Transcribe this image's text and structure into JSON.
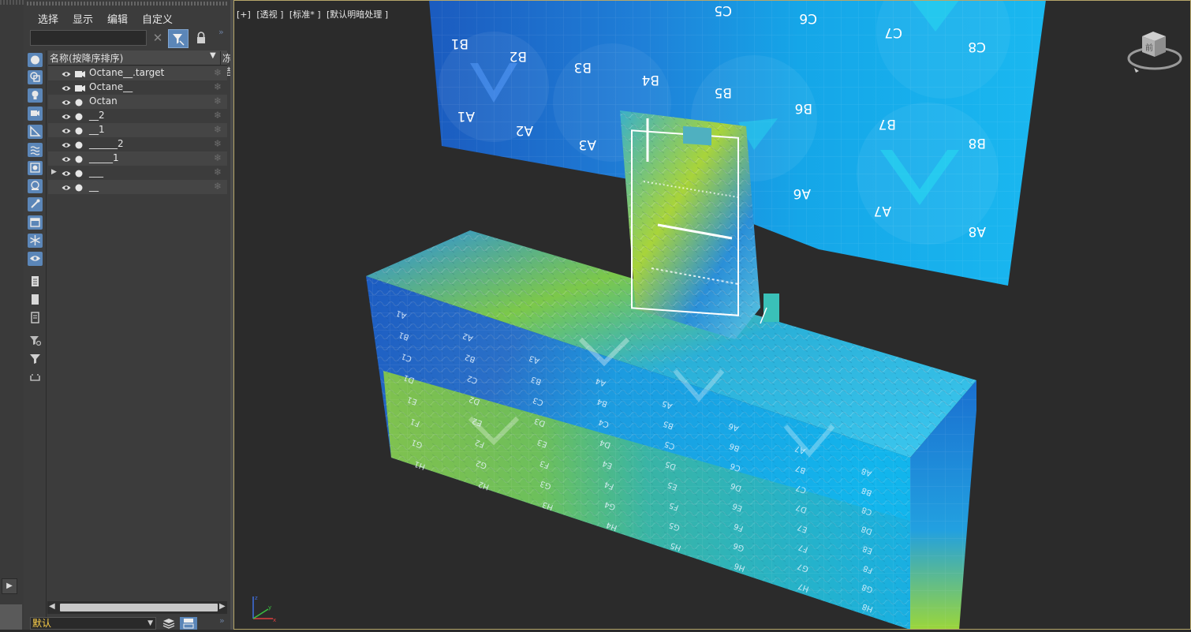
{
  "explorer": {
    "menu": {
      "select": "选择",
      "display": "显示",
      "edit": "编辑",
      "customize": "自定义"
    },
    "search": {
      "value": "",
      "placeholder": ""
    },
    "columns": {
      "name": "名称(按降序排序)",
      "frozen": "冻结"
    },
    "items": [
      {
        "label": "Octane__.target",
        "type": "camera",
        "expanded": false
      },
      {
        "label": "Octane__",
        "type": "camera",
        "expanded": false
      },
      {
        "label": "Octan",
        "type": "geometry",
        "expanded": false
      },
      {
        "label": "__2",
        "type": "geometry",
        "expanded": false
      },
      {
        "label": "__1",
        "type": "geometry",
        "expanded": false
      },
      {
        "label": "______2",
        "type": "geometry",
        "expanded": false
      },
      {
        "label": "_____1",
        "type": "geometry",
        "expanded": false
      },
      {
        "label": "___",
        "type": "geometry",
        "expanded": true
      },
      {
        "label": "__",
        "type": "geometry",
        "expanded": false
      }
    ],
    "layer": {
      "value": "默认"
    },
    "colors": {
      "accent": "#5b86b8",
      "layer_text": "#ffd24a",
      "viewport_border": "#b6a66a"
    }
  },
  "viewport": {
    "labels": [
      "[+]",
      "[透视 ]",
      "[标准* ]",
      "[默认明暗处理 ]"
    ],
    "viewcube_face": "前",
    "wall": {
      "row_c": [
        "C5",
        "C6",
        "C7",
        "C8"
      ],
      "row_b_left": [
        "B1",
        "B2",
        "B3",
        "B4"
      ],
      "row_b_right": [
        "B5",
        "B6",
        "B7",
        "B8"
      ],
      "row_a_left": [
        "A1",
        "A2",
        "A3"
      ],
      "row_a_right": [
        "A6",
        "A7",
        "A8"
      ]
    },
    "box_front_labels": [
      "A1",
      "B1",
      "C1",
      "D1",
      "E1",
      "F1",
      "G1",
      "H1",
      "A2",
      "B2",
      "C2",
      "D2",
      "E2",
      "F2",
      "G2",
      "H2",
      "A3",
      "B3",
      "C3",
      "D3",
      "E3",
      "F3",
      "G3",
      "H3",
      "A4",
      "B4",
      "C4",
      "D4",
      "E4",
      "F4",
      "G4",
      "H4",
      "A5",
      "B5",
      "C5",
      "D5",
      "E5",
      "F5",
      "G5",
      "H5",
      "A6",
      "B6",
      "C6",
      "D6",
      "E6",
      "F6",
      "G6",
      "H6",
      "A7",
      "B7",
      "C7",
      "D7",
      "E7",
      "F7",
      "G7",
      "H7",
      "A8",
      "B8",
      "C8",
      "D8",
      "E8",
      "F8",
      "G8",
      "H8"
    ]
  }
}
